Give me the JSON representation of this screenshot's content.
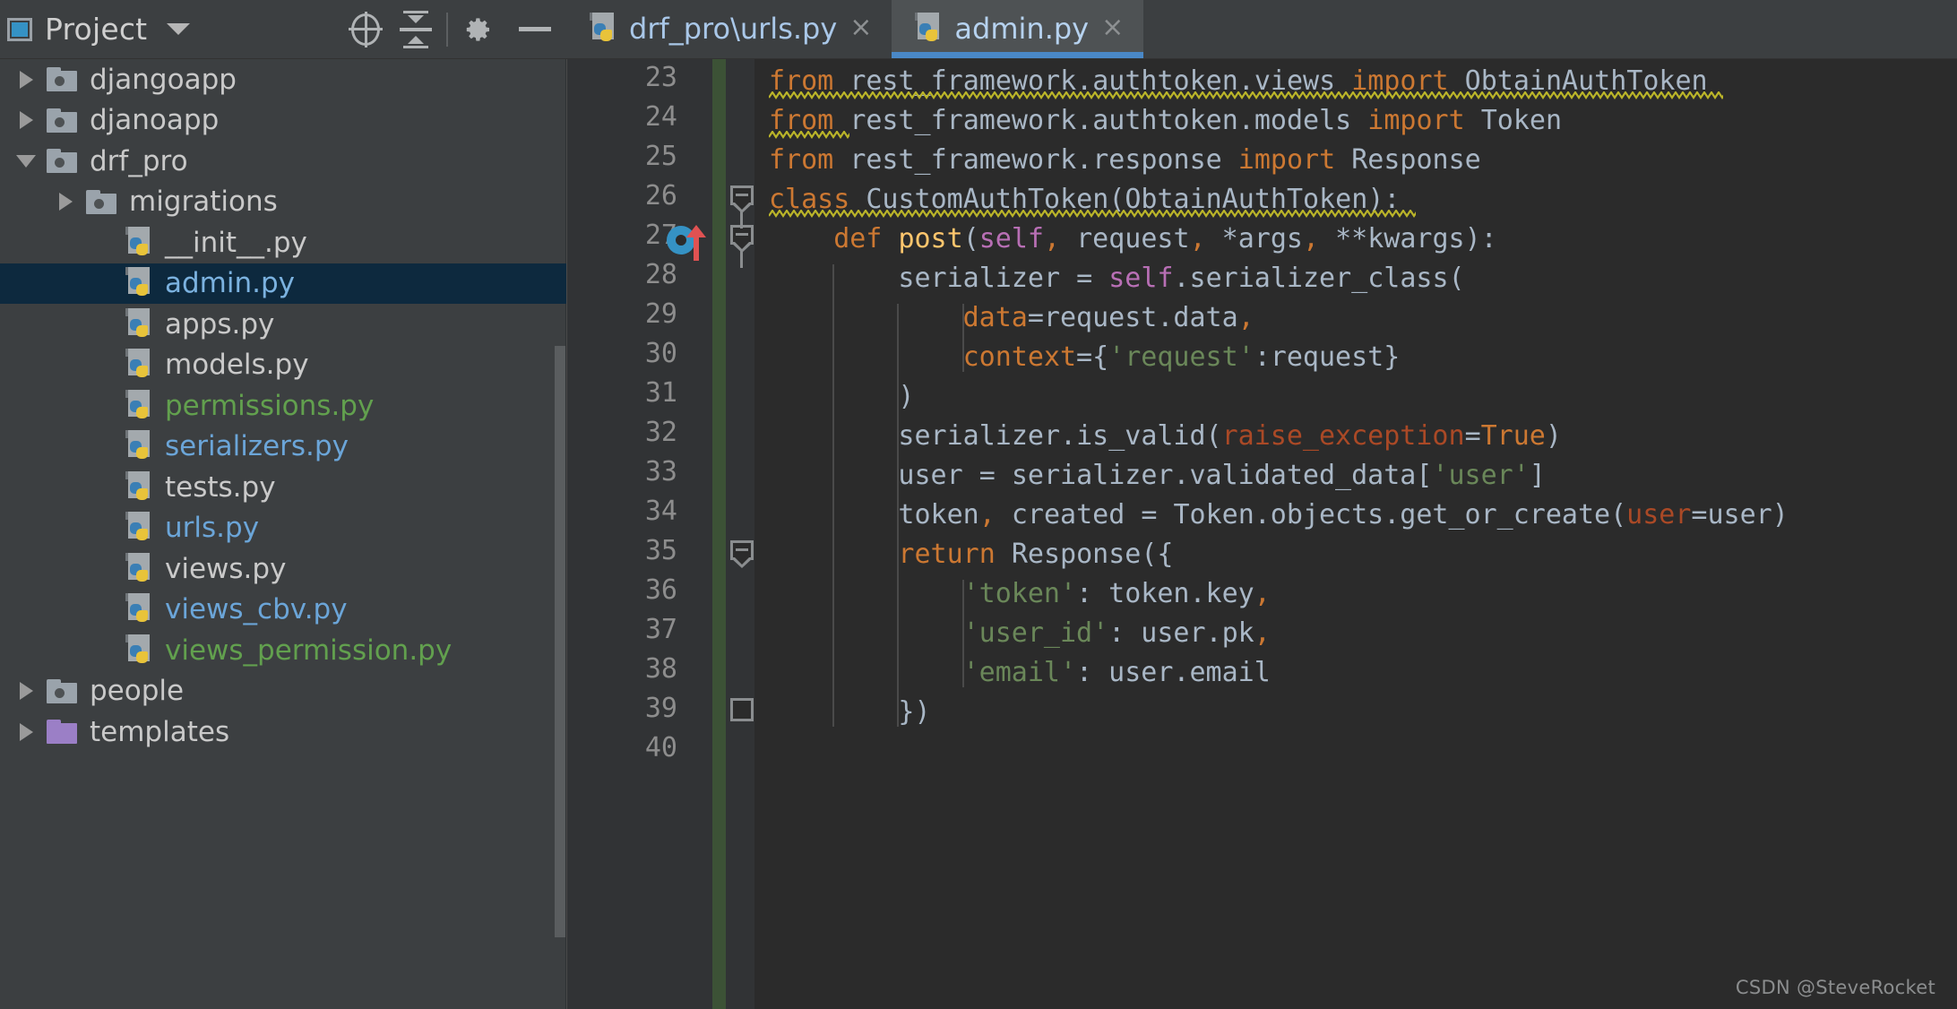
{
  "project_panel": {
    "title": "Project",
    "window_icon": "project-window-icon",
    "dropdown_icon": "chevron-down-icon",
    "toolbar": [
      {
        "name": "locate-icon",
        "label": "Select Opened File"
      },
      {
        "name": "collapse-all-icon",
        "label": "Collapse All"
      },
      {
        "name": "gear-icon",
        "label": "Settings"
      },
      {
        "name": "minimize-icon",
        "label": "Hide"
      }
    ]
  },
  "tree": {
    "items": [
      {
        "label": "djangoapp",
        "type": "folder",
        "depth": 0,
        "arrow": "closed",
        "color": "default",
        "selected": false
      },
      {
        "label": "djanoapp",
        "type": "folder",
        "depth": 0,
        "arrow": "closed",
        "color": "default",
        "selected": false
      },
      {
        "label": "drf_pro",
        "type": "folder",
        "depth": 0,
        "arrow": "open",
        "color": "default",
        "selected": false
      },
      {
        "label": "migrations",
        "type": "folder",
        "depth": 1,
        "arrow": "closed",
        "color": "default",
        "selected": false
      },
      {
        "label": "__init__.py",
        "type": "python",
        "depth": 2,
        "arrow": "none",
        "color": "default",
        "selected": false
      },
      {
        "label": "admin.py",
        "type": "python",
        "depth": 2,
        "arrow": "none",
        "color": "selblue",
        "selected": true
      },
      {
        "label": "apps.py",
        "type": "python",
        "depth": 2,
        "arrow": "none",
        "color": "default",
        "selected": false
      },
      {
        "label": "models.py",
        "type": "python",
        "depth": 2,
        "arrow": "none",
        "color": "default",
        "selected": false
      },
      {
        "label": "permissions.py",
        "type": "python",
        "depth": 2,
        "arrow": "none",
        "color": "green",
        "selected": false
      },
      {
        "label": "serializers.py",
        "type": "python",
        "depth": 2,
        "arrow": "none",
        "color": "blue",
        "selected": false
      },
      {
        "label": "tests.py",
        "type": "python",
        "depth": 2,
        "arrow": "none",
        "color": "default",
        "selected": false
      },
      {
        "label": "urls.py",
        "type": "python",
        "depth": 2,
        "arrow": "none",
        "color": "blue",
        "selected": false
      },
      {
        "label": "views.py",
        "type": "python",
        "depth": 2,
        "arrow": "none",
        "color": "default",
        "selected": false
      },
      {
        "label": "views_cbv.py",
        "type": "python",
        "depth": 2,
        "arrow": "none",
        "color": "blue",
        "selected": false
      },
      {
        "label": "views_permission.py",
        "type": "python",
        "depth": 2,
        "arrow": "none",
        "color": "green",
        "selected": false
      },
      {
        "label": "people",
        "type": "folder",
        "depth": 0,
        "arrow": "closed",
        "color": "default",
        "selected": false
      },
      {
        "label": "templates",
        "type": "folder-violet",
        "depth": 0,
        "arrow": "closed",
        "color": "default",
        "selected": false
      }
    ]
  },
  "tabs": [
    {
      "label": "drf_pro\\urls.py",
      "icon": "python-file-icon",
      "close": "×",
      "active": false
    },
    {
      "label": "admin.py",
      "icon": "python-file-icon",
      "close": "×",
      "active": true
    }
  ],
  "editor": {
    "first_line": 23,
    "line_numbers": [
      "23",
      "24",
      "25",
      "26",
      "27",
      "28",
      "29",
      "30",
      "31",
      "32",
      "33",
      "34",
      "35",
      "36",
      "37",
      "38",
      "39",
      "40"
    ],
    "gutter_icons": [
      {
        "name": "override-method-icon",
        "line": 27
      },
      {
        "name": "code-fold-icon",
        "line": 26
      },
      {
        "name": "code-fold-icon",
        "line": 27
      },
      {
        "name": "code-fold-icon",
        "line": 35
      },
      {
        "name": "code-fold-end-icon",
        "line": 39
      }
    ],
    "lines": [
      {
        "n": 23,
        "indent": 0,
        "tokens": [
          {
            "t": "from",
            "c": "kw"
          },
          {
            "t": " ",
            "c": "pln"
          },
          {
            "t": "rest_framework.authtoken.views",
            "c": "pln"
          },
          {
            "t": " ",
            "c": "pln"
          },
          {
            "t": "import",
            "c": "kw"
          },
          {
            "t": " ",
            "c": "pln"
          },
          {
            "t": "ObtainAuthToken",
            "c": "pln"
          }
        ],
        "warn": {
          "start": 0,
          "len": 59
        }
      },
      {
        "n": 24,
        "indent": 0,
        "tokens": [
          {
            "t": "from",
            "c": "kw"
          },
          {
            "t": " ",
            "c": "pln"
          },
          {
            "t": "rest_framework.authtoken.models",
            "c": "pln"
          },
          {
            "t": " ",
            "c": "pln"
          },
          {
            "t": "import",
            "c": "kw"
          },
          {
            "t": " ",
            "c": "pln"
          },
          {
            "t": "Token",
            "c": "pln"
          }
        ],
        "warn": {
          "start": 0,
          "len": 5
        }
      },
      {
        "n": 25,
        "indent": 0,
        "tokens": [
          {
            "t": "from",
            "c": "kw"
          },
          {
            "t": " ",
            "c": "pln"
          },
          {
            "t": "rest_framework.response",
            "c": "pln"
          },
          {
            "t": " ",
            "c": "pln"
          },
          {
            "t": "import",
            "c": "kw"
          },
          {
            "t": " ",
            "c": "pln"
          },
          {
            "t": "Response",
            "c": "pln"
          }
        ]
      },
      {
        "n": 26,
        "indent": 0,
        "tokens": [
          {
            "t": "class",
            "c": "kw"
          },
          {
            "t": " ",
            "c": "pln"
          },
          {
            "t": "CustomAuthToken",
            "c": "cls"
          },
          {
            "t": "(",
            "c": "pln"
          },
          {
            "t": "ObtainAuthToken",
            "c": "pln"
          },
          {
            "t": "):",
            "c": "pln"
          }
        ],
        "warn": {
          "start": 0,
          "len": 40
        }
      },
      {
        "n": 27,
        "indent": 1,
        "tokens": [
          {
            "t": "def",
            "c": "kw"
          },
          {
            "t": " ",
            "c": "pln"
          },
          {
            "t": "post",
            "c": "def"
          },
          {
            "t": "(",
            "c": "pln"
          },
          {
            "t": "self",
            "c": "selfp"
          },
          {
            "t": ",",
            "c": "comma"
          },
          {
            "t": " request",
            "c": "pln"
          },
          {
            "t": ",",
            "c": "comma"
          },
          {
            "t": " *args",
            "c": "pln"
          },
          {
            "t": ",",
            "c": "comma"
          },
          {
            "t": " **kwargs",
            "c": "pln"
          },
          {
            "t": "):",
            "c": "pln"
          }
        ]
      },
      {
        "n": 28,
        "indent": 2,
        "tokens": [
          {
            "t": "serializer = ",
            "c": "pln"
          },
          {
            "t": "self",
            "c": "selfp"
          },
          {
            "t": ".serializer_class(",
            "c": "pln"
          }
        ]
      },
      {
        "n": 29,
        "indent": 3,
        "tokens": [
          {
            "t": "data",
            "c": "kwarg"
          },
          {
            "t": "=request.data",
            "c": "pln"
          },
          {
            "t": ",",
            "c": "comma"
          }
        ]
      },
      {
        "n": 30,
        "indent": 3,
        "tokens": [
          {
            "t": "context",
            "c": "kwarg"
          },
          {
            "t": "={",
            "c": "pln"
          },
          {
            "t": "'request'",
            "c": "str"
          },
          {
            "t": ":request}",
            "c": "pln"
          }
        ]
      },
      {
        "n": 31,
        "indent": 2,
        "tokens": [
          {
            "t": ")",
            "c": "pln"
          }
        ]
      },
      {
        "n": 32,
        "indent": 2,
        "tokens": [
          {
            "t": "serializer.is_valid(",
            "c": "pln"
          },
          {
            "t": "raise_exception",
            "c": "kwarg2"
          },
          {
            "t": "=",
            "c": "pln"
          },
          {
            "t": "True",
            "c": "kw"
          },
          {
            "t": ")",
            "c": "pln"
          }
        ]
      },
      {
        "n": 33,
        "indent": 2,
        "tokens": [
          {
            "t": "user = serializer.validated_data[",
            "c": "pln"
          },
          {
            "t": "'user'",
            "c": "str"
          },
          {
            "t": "]",
            "c": "pln"
          }
        ]
      },
      {
        "n": 34,
        "indent": 2,
        "tokens": [
          {
            "t": "token",
            "c": "pln"
          },
          {
            "t": ",",
            "c": "comma"
          },
          {
            "t": " created = Token.objects.get_or_create(",
            "c": "pln"
          },
          {
            "t": "user",
            "c": "kwarg2"
          },
          {
            "t": "=user)",
            "c": "pln"
          }
        ]
      },
      {
        "n": 35,
        "indent": 2,
        "tokens": [
          {
            "t": "return",
            "c": "kw"
          },
          {
            "t": " Response({",
            "c": "pln"
          }
        ]
      },
      {
        "n": 36,
        "indent": 3,
        "tokens": [
          {
            "t": "'token'",
            "c": "str"
          },
          {
            "t": ": token.key",
            "c": "pln"
          },
          {
            "t": ",",
            "c": "comma"
          }
        ]
      },
      {
        "n": 37,
        "indent": 3,
        "tokens": [
          {
            "t": "'user_id'",
            "c": "str"
          },
          {
            "t": ": user.pk",
            "c": "pln"
          },
          {
            "t": ",",
            "c": "comma"
          }
        ]
      },
      {
        "n": 38,
        "indent": 3,
        "tokens": [
          {
            "t": "'email'",
            "c": "str"
          },
          {
            "t": ": user.email",
            "c": "pln"
          }
        ]
      },
      {
        "n": 39,
        "indent": 2,
        "tokens": [
          {
            "t": "})",
            "c": "pln"
          }
        ]
      },
      {
        "n": 40,
        "indent": 0,
        "tokens": []
      }
    ]
  },
  "watermark": "CSDN @SteveRocket",
  "colors": {
    "panel_bg": "#3c3f41",
    "editor_bg": "#2b2b2b",
    "gutter_bg": "#313335",
    "tab_active_bg": "#4e5254",
    "tab_underline": "#4a88c7",
    "tree_selection": "#0d293e",
    "vcs_added_bar": "#3c5236",
    "keyword": "#cc7832",
    "function": "#ffc66d",
    "string": "#6a8759",
    "plain": "#a9b7c6",
    "self": "#b86fb5",
    "warn_squiggle": "#bbb529",
    "file_green": "#62a04e",
    "file_blue": "#6ba5d8"
  }
}
